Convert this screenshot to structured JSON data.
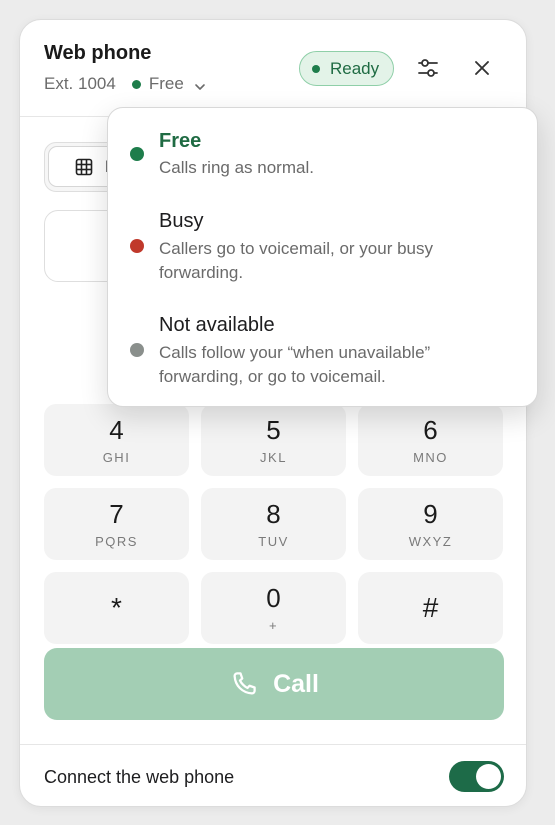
{
  "header": {
    "title": "Web phone",
    "extension": "Ext. 1004",
    "status": "Free",
    "ready_label": "Ready"
  },
  "tabs": {
    "active_label": "K"
  },
  "keypad": {
    "keys": [
      {
        "digit": "4",
        "letters": "GHI"
      },
      {
        "digit": "5",
        "letters": "JKL"
      },
      {
        "digit": "6",
        "letters": "MNO"
      },
      {
        "digit": "7",
        "letters": "PQRS"
      },
      {
        "digit": "8",
        "letters": "TUV"
      },
      {
        "digit": "9",
        "letters": "WXYZ"
      },
      {
        "digit": "*",
        "letters": ""
      },
      {
        "digit": "0",
        "letters": "+"
      },
      {
        "digit": "#",
        "letters": ""
      }
    ]
  },
  "call_label": "Call",
  "footer": {
    "label": "Connect the web phone",
    "toggle_on": true
  },
  "status_menu": {
    "options": [
      {
        "label": "Free",
        "desc": "Calls ring as normal.",
        "color": "#1e7d4b",
        "selected": true
      },
      {
        "label": "Busy",
        "desc": "Callers go to voicemail, or your busy forwarding.",
        "color": "#c0392b",
        "selected": false
      },
      {
        "label": "Not available",
        "desc": "Calls follow your “when unavailable” forwarding, or go to voicemail.",
        "color": "#8a8f8c",
        "selected": false
      }
    ]
  },
  "colors": {
    "accent": "#1e7d4b",
    "call_button": "#a3ceb4",
    "toggle": "#1d6b48"
  }
}
